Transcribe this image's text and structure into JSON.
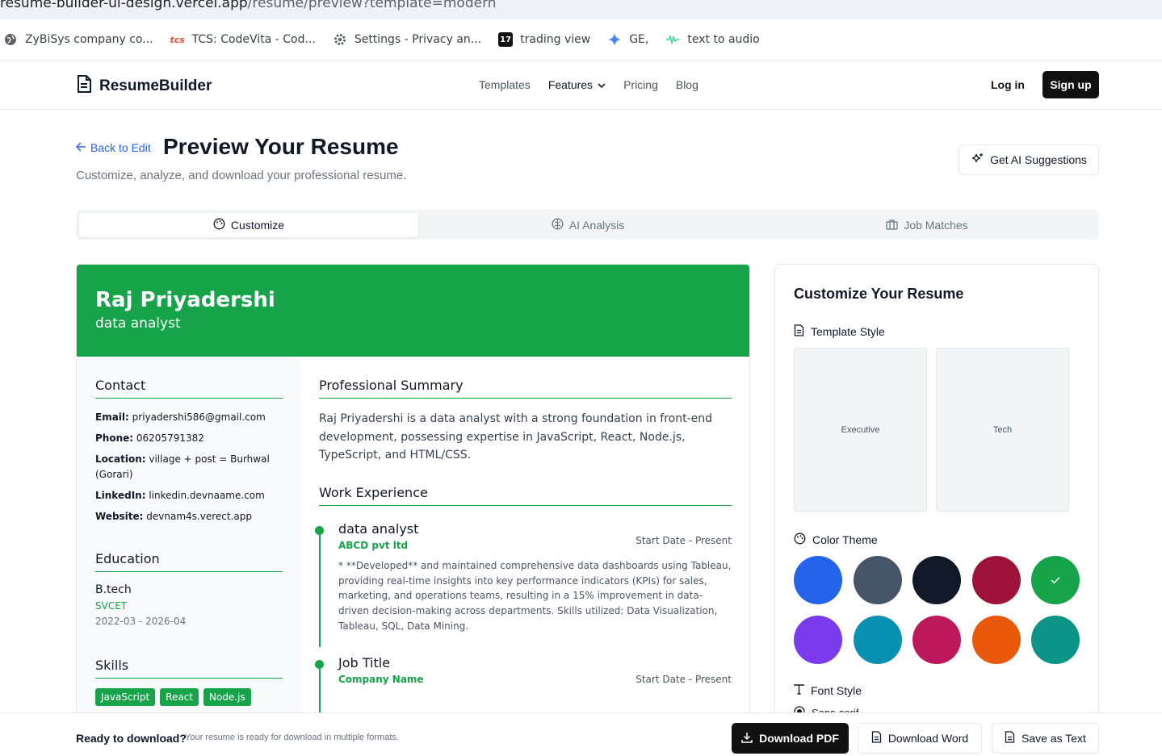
{
  "browser": {
    "url_host": "resume-builder-ui-design.vercel.app",
    "url_path": "/resume/preview?template=modern",
    "bookmarks": [
      {
        "label": "ZyBiSys company co...",
        "icon": "globe-icon"
      },
      {
        "label": "TCS: CodeVita - Cod...",
        "icon": "tcs-icon"
      },
      {
        "label": "Settings - Privacy an...",
        "icon": "gear-icon"
      },
      {
        "label": "trading view",
        "icon": "tradingview-icon"
      },
      {
        "label": "GE,",
        "icon": "gemini-icon"
      },
      {
        "label": "text to audio",
        "icon": "waveform-icon"
      }
    ]
  },
  "nav": {
    "brand": "ResumeBuilder",
    "links": [
      "Templates",
      "Features",
      "Pricing",
      "Blog"
    ],
    "login": "Log in",
    "signup": "Sign up"
  },
  "header": {
    "back": "Back to Edit",
    "title": "Preview Your Resume",
    "subtitle": "Customize, analyze, and download your professional resume.",
    "ai_button": "Get AI Suggestions"
  },
  "tabs": [
    {
      "label": "Customize",
      "icon": "palette-icon",
      "selected": true
    },
    {
      "label": "AI Analysis",
      "icon": "brain-icon",
      "selected": false
    },
    {
      "label": "Job Matches",
      "icon": "briefcase-icon",
      "selected": false
    }
  ],
  "resume": {
    "name": "Raj Priyadershi",
    "role": "data analyst",
    "contact_heading": "Contact",
    "contact": [
      {
        "label": "Email:",
        "value": "priyadershi586@gmail.com"
      },
      {
        "label": "Phone:",
        "value": "06205791382"
      },
      {
        "label": "Location:",
        "value": "village + post = Burhwal (Gorari)"
      },
      {
        "label": "LinkedIn:",
        "value": "linkedin.devnaame.com"
      },
      {
        "label": "Website:",
        "value": "devnam4s.verect.app"
      }
    ],
    "education_heading": "Education",
    "education": {
      "degree": "B.tech",
      "school": "SVCET",
      "dates": "2022-03 - 2026-04"
    },
    "skills_heading": "Skills",
    "skills": [
      "JavaScript",
      "React",
      "Node.js"
    ],
    "summary_heading": "Professional Summary",
    "summary": "Raj Priyadershi is a data analyst with a strong foundation in front-end development, possessing expertise in JavaScript, React, Node.js, TypeScript, and HTML/CSS.",
    "experience_heading": "Work Experience",
    "jobs": [
      {
        "title": "data analyst",
        "company": "ABCD pvt ltd",
        "dates": "Start Date - Present",
        "description": "* **Developed** and maintained comprehensive data dashboards using Tableau, providing real-time insights into key performance indicators (KPIs) for sales, marketing, and operations teams, resulting in a 15% improvement in data-driven decision-making across departments. Skills utilized: Data Visualization, Tableau, SQL, Data Mining."
      },
      {
        "title": "Job Title",
        "company": "Company Name",
        "dates": "Start Date - Present",
        "description": ""
      }
    ],
    "accent_color": "#16a34a"
  },
  "customize": {
    "title": "Customize Your Resume",
    "template_label": "Template Style",
    "templates": [
      "Executive",
      "Tech"
    ],
    "color_label": "Color Theme",
    "colors": [
      "#2563eb",
      "#475569",
      "#111827",
      "#9f1239",
      "#16a34a",
      "#7c3aed",
      "#0891b2",
      "#be185d",
      "#ea580c",
      "#0d9488"
    ],
    "selected_color": "#16a34a",
    "font_label": "Font Style",
    "font_option": "Sans-serif"
  },
  "bottom": {
    "ready": "Ready to download?",
    "ready_sub": "Your resume is ready for download in multiple formats.",
    "pdf": "Download PDF",
    "word": "Download Word",
    "text": "Save as Text"
  }
}
